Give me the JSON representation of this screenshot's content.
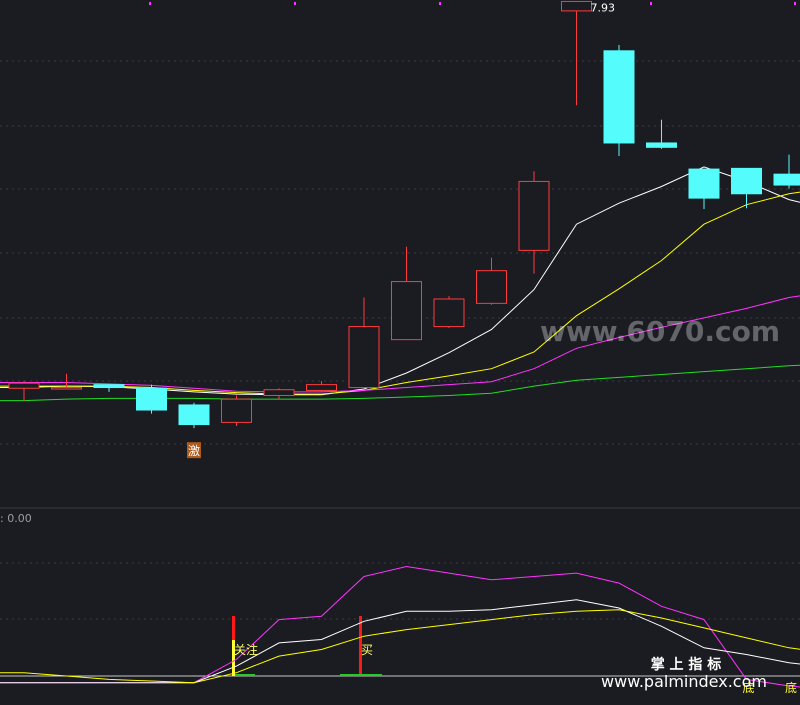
{
  "chart_data": [
    {
      "type": "candlestick",
      "ylim": [
        2.6,
        9.6
      ],
      "grid": true,
      "annotations": [
        {
          "label": "7.93",
          "index": 13
        },
        {
          "label": "激",
          "index": 4
        }
      ],
      "candles": [
        {
          "open": 4.25,
          "close": 4.32,
          "high": 4.35,
          "low": 4.07
        },
        {
          "open": 4.26,
          "close": 4.26,
          "high": 4.45,
          "low": 4.26
        },
        {
          "open": 4.3,
          "close": 4.26,
          "high": 4.3,
          "low": 4.2
        },
        {
          "open": 4.25,
          "close": 3.95,
          "high": 4.3,
          "low": 3.9
        },
        {
          "open": 4.02,
          "close": 3.75,
          "high": 4.05,
          "low": 3.7
        },
        {
          "open": 3.78,
          "close": 4.1,
          "high": 4.15,
          "low": 3.73
        },
        {
          "open": 4.15,
          "close": 4.23,
          "high": 4.25,
          "low": 4.1
        },
        {
          "open": 4.22,
          "close": 4.3,
          "high": 4.35,
          "low": 4.2
        },
        {
          "open": 4.26,
          "close": 5.1,
          "high": 5.5,
          "low": 4.26
        },
        {
          "open": 4.92,
          "close": 5.72,
          "high": 6.2,
          "low": 4.92
        },
        {
          "open": 5.1,
          "close": 5.48,
          "high": 5.52,
          "low": 5.08
        },
        {
          "open": 5.42,
          "close": 5.87,
          "high": 6.05,
          "low": 5.4
        },
        {
          "open": 6.15,
          "close": 7.1,
          "high": 7.24,
          "low": 5.83
        },
        {
          "open": 9.45,
          "close": 9.58,
          "high": 9.58,
          "low": 8.15
        },
        {
          "open": 8.9,
          "close": 7.63,
          "high": 8.98,
          "low": 7.45
        },
        {
          "open": 7.63,
          "close": 7.57,
          "high": 7.95,
          "low": 7.55
        },
        {
          "open": 7.27,
          "close": 6.87,
          "high": 7.27,
          "low": 6.72
        },
        {
          "open": 7.28,
          "close": 6.93,
          "high": 7.28,
          "low": 6.73
        },
        {
          "open": 7.2,
          "close": 7.05,
          "high": 7.47,
          "low": 7.0
        }
      ],
      "series": [
        {
          "color": "#ffffff",
          "values": [
            4.26,
            4.28,
            4.27,
            4.24,
            4.2,
            4.17,
            4.16,
            4.16,
            4.24,
            4.46,
            4.74,
            5.06,
            5.61,
            6.51,
            6.8,
            7.03,
            7.3,
            7.1,
            6.85
          ]
        },
        {
          "color": "#ffff00",
          "values": [
            4.28,
            4.28,
            4.28,
            4.26,
            4.22,
            4.19,
            4.17,
            4.17,
            4.22,
            4.33,
            4.42,
            4.52,
            4.75,
            5.25,
            5.62,
            6.01,
            6.51,
            6.78,
            6.93
          ]
        },
        {
          "color": "#ff33ff",
          "values": [
            4.33,
            4.33,
            4.31,
            4.29,
            4.25,
            4.21,
            4.2,
            4.2,
            4.22,
            4.26,
            4.3,
            4.34,
            4.52,
            4.8,
            4.95,
            5.09,
            5.22,
            5.35,
            5.5
          ]
        },
        {
          "color": "#22dd22",
          "values": [
            4.08,
            4.1,
            4.11,
            4.11,
            4.11,
            4.1,
            4.1,
            4.1,
            4.11,
            4.13,
            4.15,
            4.18,
            4.28,
            4.36,
            4.4,
            4.44,
            4.48,
            4.52,
            4.56
          ]
        }
      ]
    },
    {
      "type": "line",
      "readout": ": 0.00",
      "ylim": [
        -0.1,
        4.6
      ],
      "grid": true,
      "series": [
        {
          "color": "#ff33ff",
          "values": [
            0.0,
            0.0,
            0.0,
            0.0,
            0.0,
            0.7,
            1.9,
            2.0,
            3.2,
            3.5,
            3.3,
            3.1,
            3.2,
            3.3,
            3.0,
            2.3,
            1.9,
            0.1,
            -0.1
          ]
        },
        {
          "color": "#ffffff",
          "values": [
            0.0,
            0.0,
            0.0,
            0.0,
            0.0,
            0.5,
            1.2,
            1.3,
            1.85,
            2.15,
            2.15,
            2.2,
            2.35,
            2.5,
            2.25,
            1.7,
            1.05,
            0.85,
            0.6
          ]
        },
        {
          "color": "#ffff00",
          "values": [
            0.3,
            0.2,
            0.1,
            0.05,
            0.0,
            0.3,
            0.8,
            1.0,
            1.4,
            1.6,
            1.75,
            1.9,
            2.05,
            2.15,
            2.2,
            1.95,
            1.65,
            1.35,
            1.05
          ]
        }
      ],
      "signals": [
        {
          "label": "关注",
          "index": 5
        },
        {
          "label": "买",
          "index": 8
        },
        {
          "label": "底",
          "index": 17
        },
        {
          "label": "底",
          "index": 18
        }
      ]
    }
  ],
  "watermarks": {
    "site": "www.6070.com",
    "brand": "掌 上 指 标",
    "url": "www.palmindex.com"
  }
}
